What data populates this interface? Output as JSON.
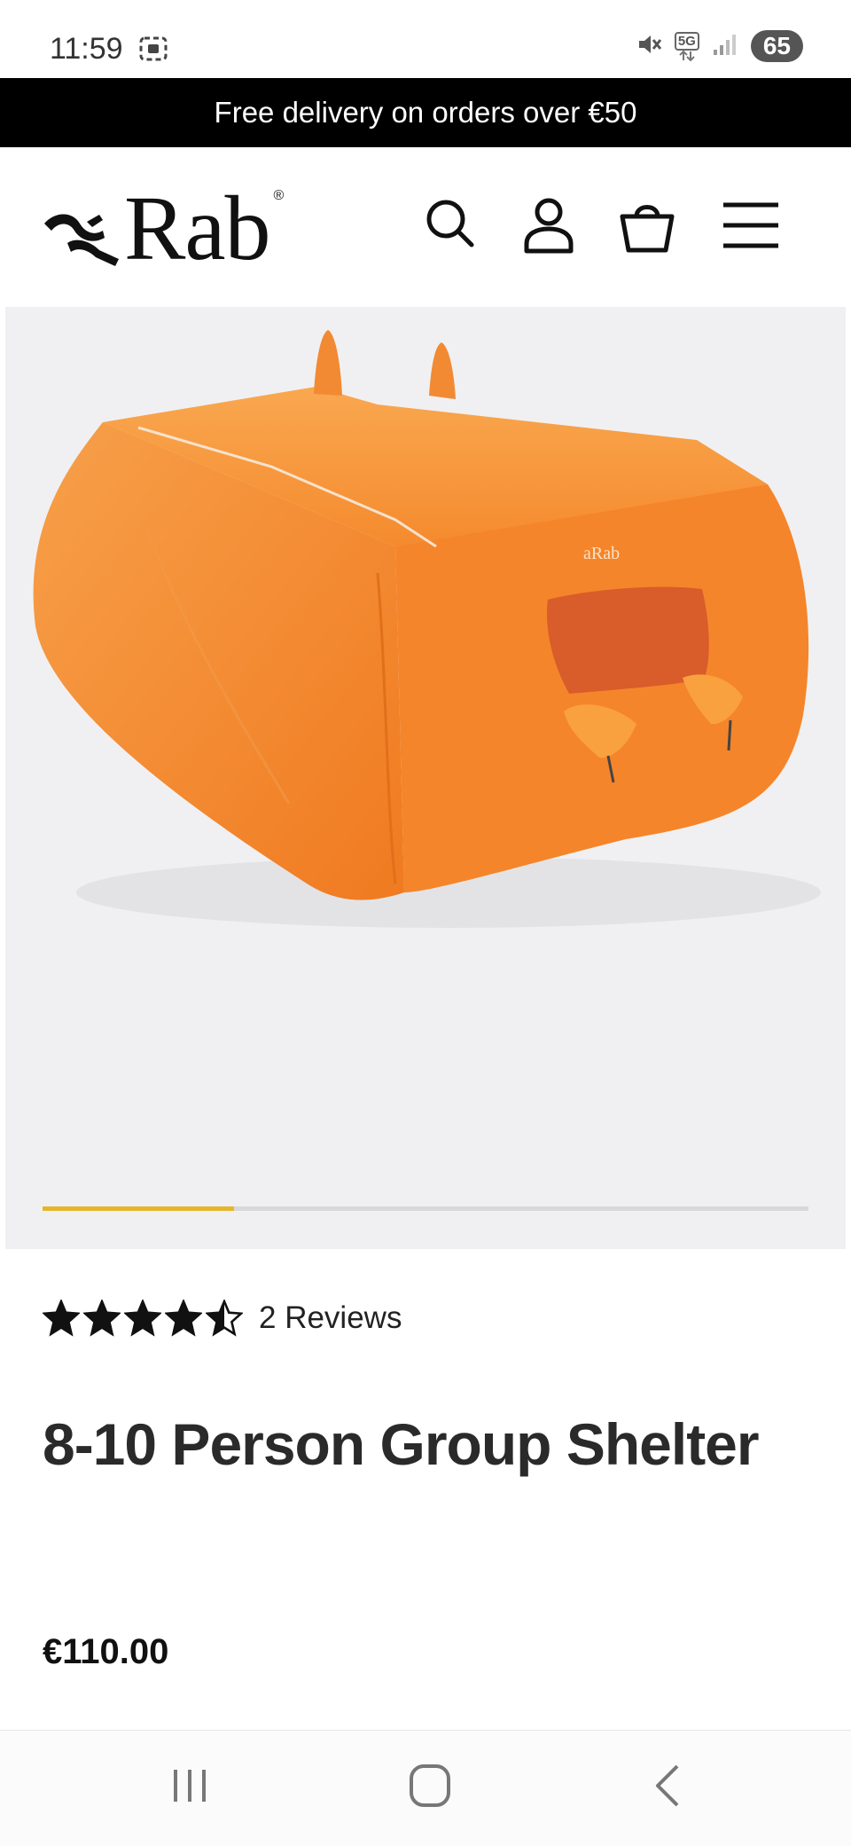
{
  "status_bar": {
    "time": "11:59",
    "network": "5G",
    "battery": "65",
    "icons": [
      "screenshot-icon",
      "mute-icon",
      "signal-icon"
    ]
  },
  "promo": {
    "text": "Free delivery on orders over €50"
  },
  "header": {
    "logo": "Rab",
    "logo_reg": "®",
    "icons": [
      "search-icon",
      "account-icon",
      "bag-icon",
      "menu-icon"
    ]
  },
  "gallery": {
    "image": "orange group shelter tent",
    "slide_progress": 0.25
  },
  "product": {
    "rating": 4.5,
    "reviews_label": "2 Reviews",
    "title": "8-10 Person Group Shelter",
    "price": "€110.00"
  },
  "colors": {
    "accent": "#e5b62a",
    "tent_orange": "#f58a2e",
    "promo_bg": "#000000",
    "gallery_bg": "#f0f0f2"
  }
}
